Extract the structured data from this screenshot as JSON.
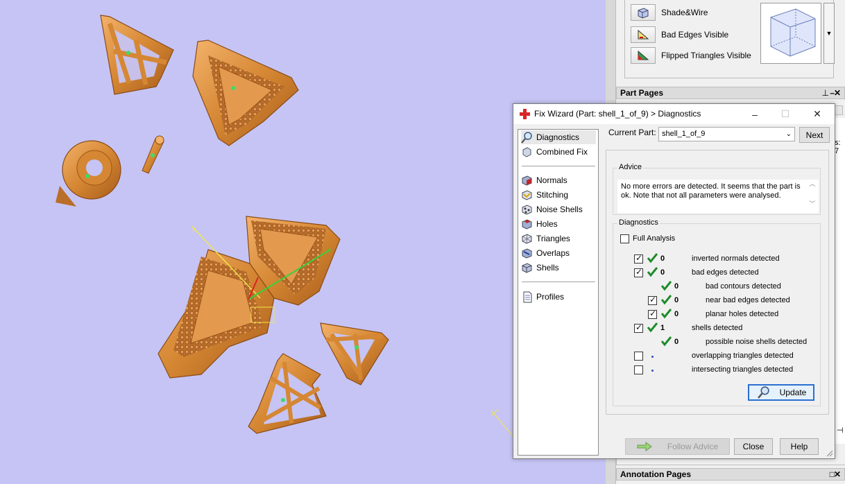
{
  "view_options": {
    "shade_wire": "Shade&Wire",
    "bad_edges": "Bad Edges Visible",
    "flipped": "Flipped Triangles Visible"
  },
  "panels": {
    "part_pages": "Part Pages",
    "annotation_pages": "Annotation Pages",
    "bg_tab": "es",
    "bg_text": "s: 7"
  },
  "dialog": {
    "title": "Fix Wizard (Part: shell_1_of_9) > Diagnostics",
    "nav": [
      {
        "label": "Diagnostics",
        "icon": "magnifier-icon"
      },
      {
        "label": "Combined Fix",
        "icon": "combined-fix-icon"
      },
      {
        "label": "Normals",
        "icon": "normals-icon"
      },
      {
        "label": "Stitching",
        "icon": "stitching-icon"
      },
      {
        "label": "Noise Shells",
        "icon": "noise-shells-icon"
      },
      {
        "label": "Holes",
        "icon": "holes-icon"
      },
      {
        "label": "Triangles",
        "icon": "triangles-icon"
      },
      {
        "label": "Overlaps",
        "icon": "overlaps-icon"
      },
      {
        "label": "Shells",
        "icon": "shells-icon"
      },
      {
        "label": "Profiles",
        "icon": "profiles-icon"
      }
    ],
    "current_part_label": "Current Part:",
    "current_part_value": "shell_1_of_9",
    "next_label": "Next",
    "advice_title": "Advice",
    "advice_text": "No more errors are detected. It seems that the part is ok. Note that not all parameters were analysed.",
    "diagnostics_title": "Diagnostics",
    "full_analysis_label": "Full Analysis",
    "rows": [
      {
        "checked": true,
        "status": "ok",
        "count": "0",
        "text": "inverted normals detected"
      },
      {
        "checked": true,
        "status": "ok",
        "count": "0",
        "text": "bad edges detected"
      },
      {
        "checked": null,
        "status": "ok",
        "count": "0",
        "text": "bad contours detected"
      },
      {
        "checked": true,
        "status": "ok",
        "count": "0",
        "text": "near bad edges detected"
      },
      {
        "checked": true,
        "status": "ok",
        "count": "0",
        "text": "planar holes detected"
      },
      {
        "checked": true,
        "status": "ok",
        "count": "1",
        "text": "shells detected"
      },
      {
        "checked": null,
        "status": "ok",
        "count": "0",
        "text": "possible noise shells detected"
      },
      {
        "checked": false,
        "status": "dot",
        "count": "",
        "text": "overlapping triangles detected"
      },
      {
        "checked": false,
        "status": "dot",
        "count": "",
        "text": "intersecting triangles detected"
      }
    ],
    "update_label": "Update",
    "follow_label": "Follow Advice",
    "close_label": "Close",
    "help_label": "Help"
  },
  "colors": {
    "viewport_bg": "#c6c4f4",
    "gold": "#d98a3c",
    "tick_green": "#1d8a2a"
  }
}
